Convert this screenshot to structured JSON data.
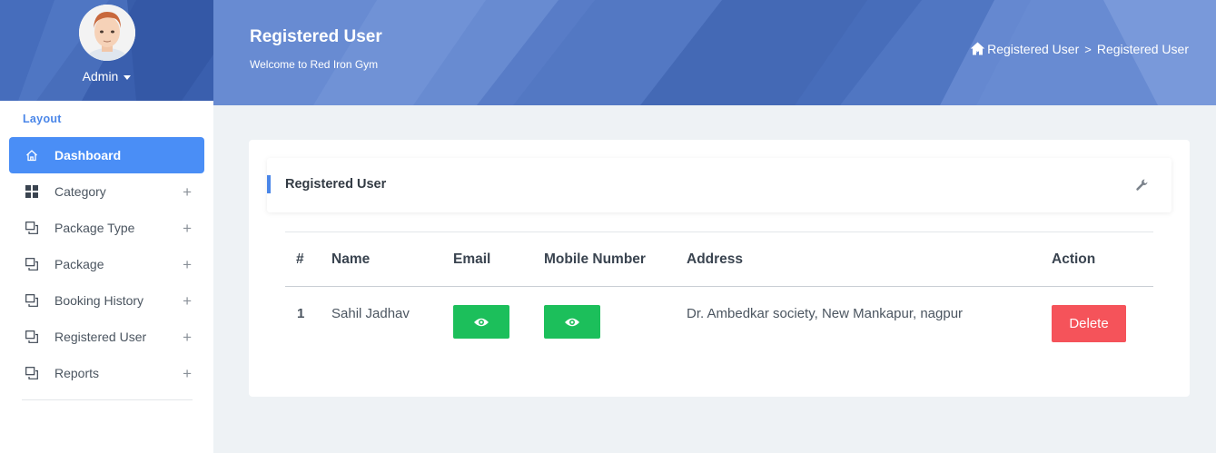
{
  "sidebar": {
    "user_name": "Admin",
    "section_label": "Layout",
    "items": [
      {
        "label": "Dashboard",
        "icon": "home-icon",
        "active": true
      },
      {
        "label": "Category",
        "icon": "grid-icon",
        "expandable": true
      },
      {
        "label": "Package Type",
        "icon": "copy-icon",
        "expandable": true
      },
      {
        "label": "Package",
        "icon": "copy-icon",
        "expandable": true
      },
      {
        "label": "Booking History",
        "icon": "copy-icon",
        "expandable": true
      },
      {
        "label": "Registered User",
        "icon": "copy-icon",
        "expandable": true
      },
      {
        "label": "Reports",
        "icon": "copy-icon",
        "expandable": true
      }
    ],
    "expand_symbol": "+"
  },
  "header": {
    "title": "Registered User",
    "subtitle": "Welcome to Red Iron Gym",
    "breadcrumb": [
      "Registered User",
      "Registered User"
    ],
    "breadcrumb_sep": ">"
  },
  "card": {
    "title": "Registered User",
    "table": {
      "columns": [
        "#",
        "Name",
        "Email",
        "Mobile Number",
        "Address",
        "Action"
      ],
      "rows": [
        {
          "index": "1",
          "name": "Sahil Jadhav",
          "address": "Dr. Ambedkar society, New Mankapur, nagpur",
          "action_label": "Delete"
        }
      ]
    }
  },
  "colors": {
    "accent": "#4a8ef6",
    "banner": "#5477c4",
    "view_button": "#1cbf5b",
    "delete_button": "#f5535a"
  }
}
